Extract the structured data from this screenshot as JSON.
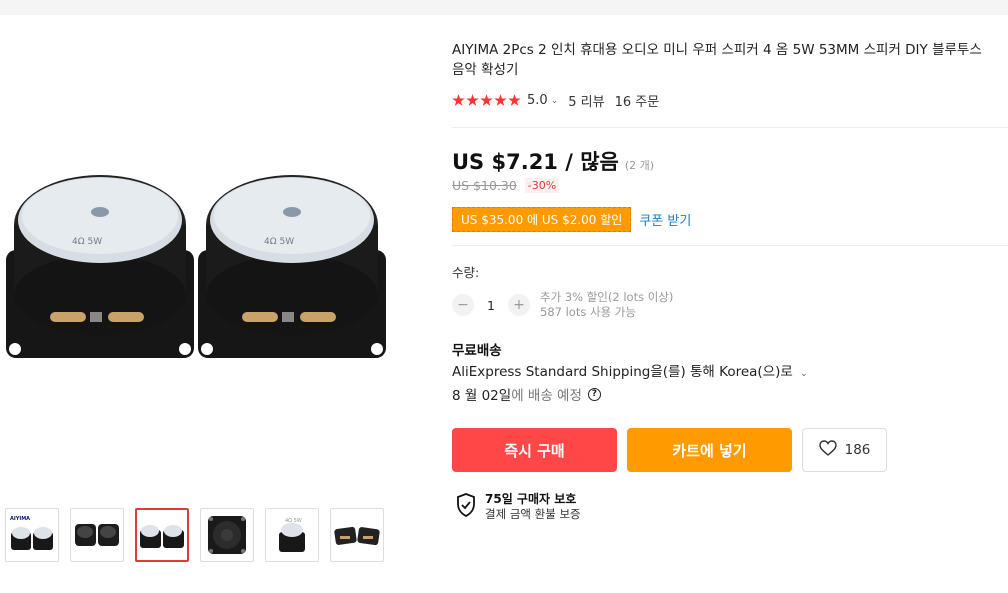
{
  "product": {
    "title": "AIYIMA 2Pcs 2 인치 휴대용 오디오 미니 우퍼 스피커 4 옴 5W 53MM 스피커 DIY 블루투스 음악 확성기",
    "rating": "5.0",
    "reviews": "5 리뷰",
    "orders": "16 주문"
  },
  "image": {
    "speaker_label": "4Ω 5W",
    "thumb_brand": "AIYIMA"
  },
  "price": {
    "current": "US $7.21 / 많음",
    "unit_note": "(2 개)",
    "original": "US $10.30",
    "discount": "-30%",
    "coupon": "US $35.00 에 US $2.00 할인",
    "coupon_link": "쿠폰 받기"
  },
  "quantity": {
    "label": "수량:",
    "minus": "−",
    "value": "1",
    "plus": "+",
    "note_discount": "추가 3% 할인(2 lots 이상)",
    "note_available": "587 lots 사용 가능"
  },
  "shipping": {
    "title": "무료배송",
    "method": "AliExpress Standard Shipping을(를) 통해 Korea(으)로",
    "date": "8 월 02일",
    "date_suffix": "에 배송 예정",
    "help": "?"
  },
  "actions": {
    "buy_now": "즉시 구매",
    "add_to_cart": "카트에 넣기",
    "wishlist_count": "186"
  },
  "protection": {
    "title": "75일 구매자 보호",
    "subtitle": "결제 금액 환불 보증"
  },
  "colors": {
    "star": "#ff3333",
    "buy": "#ff4747",
    "cart": "#ff9a00",
    "coupon_link": "#1a7fc4"
  }
}
